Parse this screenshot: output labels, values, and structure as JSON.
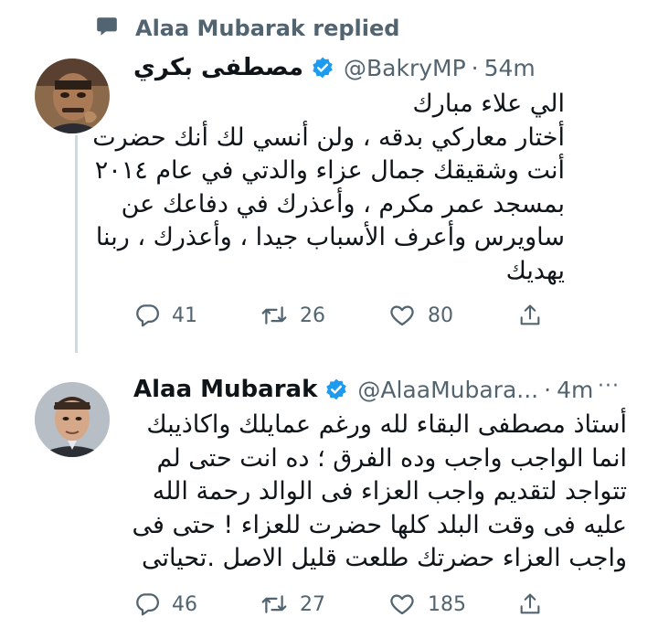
{
  "context": {
    "label": "Alaa Mubarak replied"
  },
  "tweets": [
    {
      "name": "مصطفى بكري",
      "handle": "@BakryMP",
      "separator": "·",
      "time": "54m",
      "lines": [
        "الي علاء مبارك",
        "أختار معاركي بدقه ، ولن أنسي لك أنك حضرت",
        "أنت وشقيقك جمال عزاء والدتي في عام ٢٠١٤",
        "بمسجد عمر مكرم ، وأعذرك في دفاعك عن",
        "ساويرس وأعرف الأسباب جيدا ، وأعذرك ، ربنا",
        "يهديك"
      ],
      "replies": "41",
      "retweets": "26",
      "likes": "80"
    },
    {
      "name": "Alaa Mubarak",
      "handle": "@AlaaMubara...",
      "separator": "·",
      "time": "4m",
      "more": "···",
      "lines": [
        "أستاذ مصطفى  البقاء لله ورغم عمايلك واكاذيبك",
        "انما الواجب واجب وده الفرق ؛ ده انت حتى لم",
        "تتواجد لتقديم واجب العزاء فى الوالد رحمة الله",
        "عليه فى وقت البلد كلها حضرت للعزاء !  حتى فى",
        "واجب العزاء حضرتك طلعت قليل الاصل .تحياتى"
      ],
      "replies": "46",
      "retweets": "27",
      "likes": "185"
    }
  ],
  "colors": {
    "verified": "#1d9bf0",
    "text": "#0f1419",
    "secondary": "#536471",
    "thread": "#cfd9de"
  }
}
